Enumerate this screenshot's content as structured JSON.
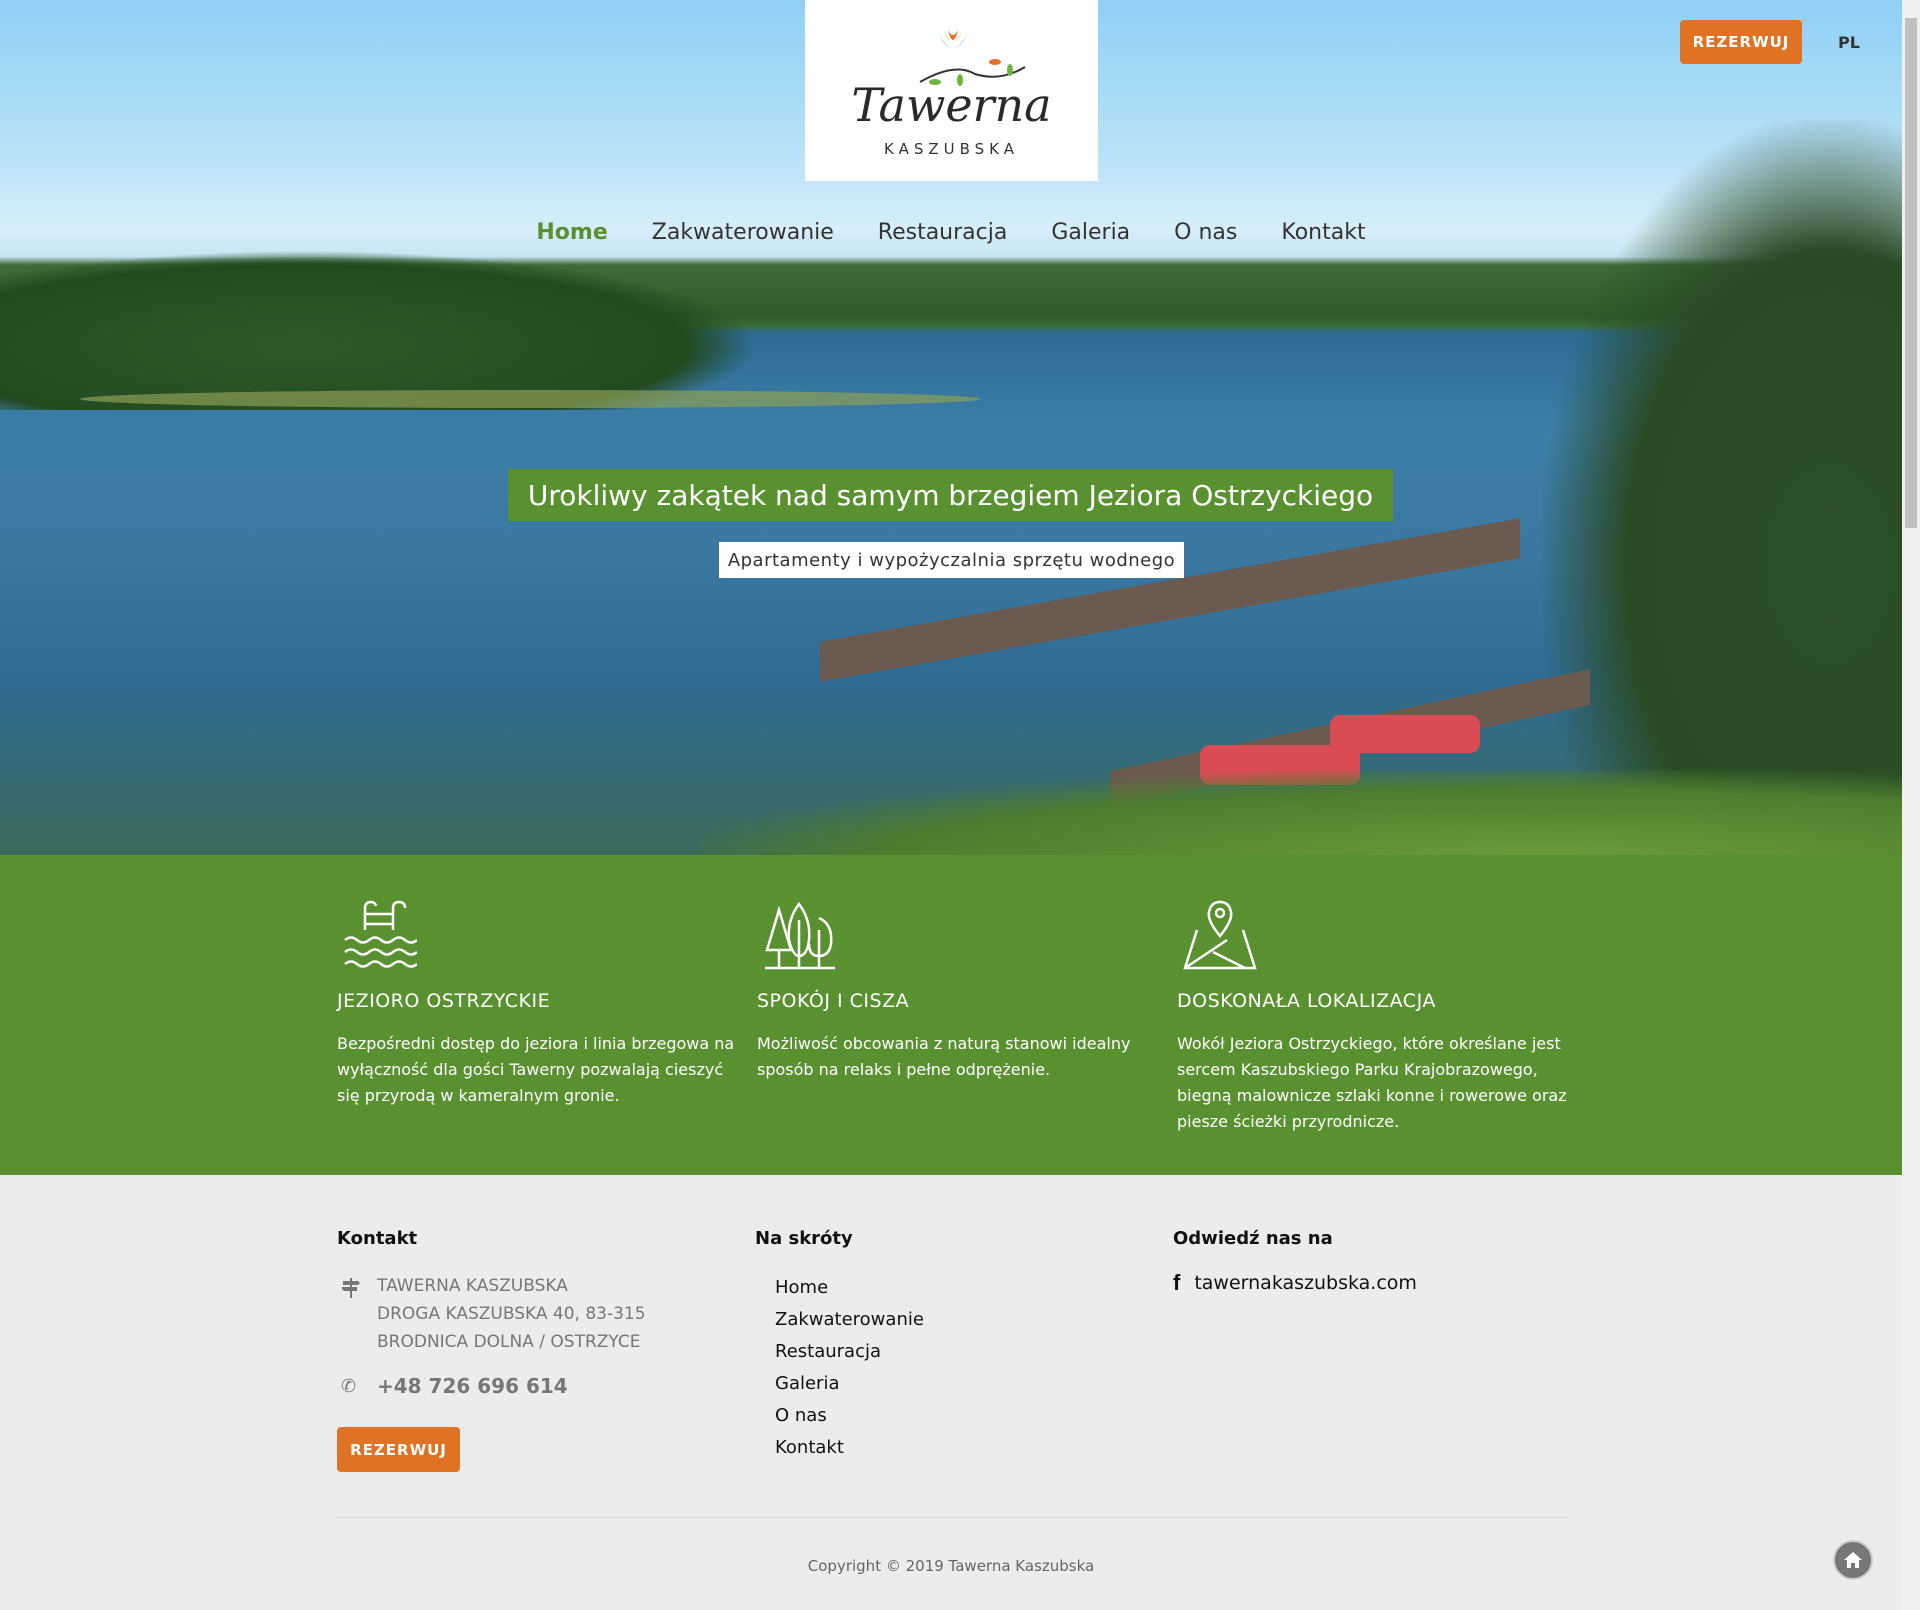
{
  "logo": {
    "script": "Tawerna",
    "sub": "KASZUBSKA"
  },
  "header": {
    "reserve_label": "REZERWUJ",
    "language": "PL"
  },
  "nav": [
    {
      "label": "Home",
      "active": true
    },
    {
      "label": "Zakwaterowanie"
    },
    {
      "label": "Restauracja"
    },
    {
      "label": "Galeria"
    },
    {
      "label": "O nas"
    },
    {
      "label": "Kontakt"
    }
  ],
  "hero": {
    "headline": "Urokliwy zakątek nad samym brzegiem Jeziora Ostrzyckiego",
    "subtitle": "Apartamenty i wypożyczalnia sprzętu wodnego"
  },
  "features": [
    {
      "icon": "lake-ladder-icon",
      "title": "JEZIORO OSTRZYCKIE",
      "text": "Bezpośredni dostęp do jeziora i linia brzegowa na wyłączność dla gości Tawerny pozwalają cieszyć się przyrodą w kameralnym gronie."
    },
    {
      "icon": "trees-icon",
      "title": "SPOKÓJ I CISZA",
      "text": "Możliwość obcowania z naturą stanowi idealny sposób na relaks i pełne odprężenie."
    },
    {
      "icon": "map-pin-icon",
      "title": "DOSKONAŁA LOKALIZACJA",
      "text": "Wokół Jeziora Ostrzyckiego, które określane jest sercem Kaszubskiego Parku Krajobrazowego, biegną malownicze szlaki konne i rowerowe oraz piesze ścieżki przyrodnicze."
    }
  ],
  "footer": {
    "contact": {
      "title": "Kontakt",
      "address": [
        "TAWERNA KASZUBSKA",
        "DROGA KASZUBSKA 40, 83-315",
        "BRODNICA DOLNA / OSTRZYCE"
      ],
      "phone": "+48 726 696 614",
      "reserve_label": "REZERWUJ"
    },
    "shortcuts": {
      "title": "Na skróty",
      "links": [
        "Home",
        "Zakwaterowanie",
        "Restauracja",
        "Galeria",
        "O nas",
        "Kontakt"
      ]
    },
    "social": {
      "title": "Odwiedź nas na",
      "facebook": "tawernakaszubska.com"
    },
    "copyright": "Copyright © 2019 Tawerna Kaszubska"
  },
  "colors": {
    "green": "#5a9130",
    "orange": "#e07224",
    "footer_bg": "#ececec"
  }
}
